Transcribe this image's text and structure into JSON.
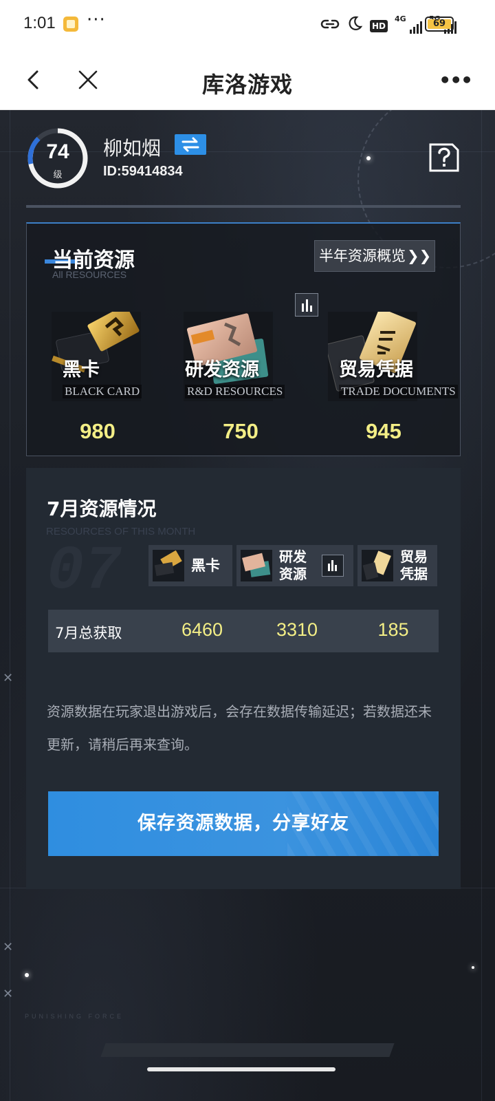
{
  "status_bar": {
    "time": "1:01",
    "dots": "···",
    "hd_label": "HD",
    "net1": "4G",
    "net2": "5G",
    "battery": "69"
  },
  "nav": {
    "title": "库洛游戏",
    "more": "•••"
  },
  "profile": {
    "level": "74",
    "level_unit": "级",
    "name": "柳如烟",
    "id": "ID:59414834"
  },
  "current_resources": {
    "title": "当前资源",
    "subtitle": "All RESOURCES",
    "overview_button": "半年资源概览",
    "overview_chevron": "❯❯",
    "items": [
      {
        "name": "黑卡",
        "en": "BLACK CARD",
        "value": "980"
      },
      {
        "name": "研发资源",
        "en": "R&D RESOURCES",
        "value": "750"
      },
      {
        "name": "贸易凭据",
        "en": "TRADE DOCUMENTS",
        "value": "945"
      }
    ]
  },
  "monthly": {
    "title": "7月资源情况",
    "subtitle": "RESOURCES OF THIS MONTH",
    "big_month": "07",
    "columns": [
      {
        "label": "黑卡"
      },
      {
        "label": "研发资源"
      },
      {
        "label": "贸易凭据"
      }
    ],
    "row_label": "7月总获取",
    "row_values": [
      "6460",
      "3310",
      "185"
    ],
    "note": "资源数据在玩家退出游戏后，会存在数据传输延迟；若数据还未更新，请稍后再来查询。",
    "save_button": "保存资源数据，分享好友"
  },
  "footer": {
    "brand": "PUNISHING FORCE"
  },
  "colors": {
    "accent_blue": "#3a87dd",
    "value_yellow": "#f3ee86",
    "panel": "#232a33"
  }
}
